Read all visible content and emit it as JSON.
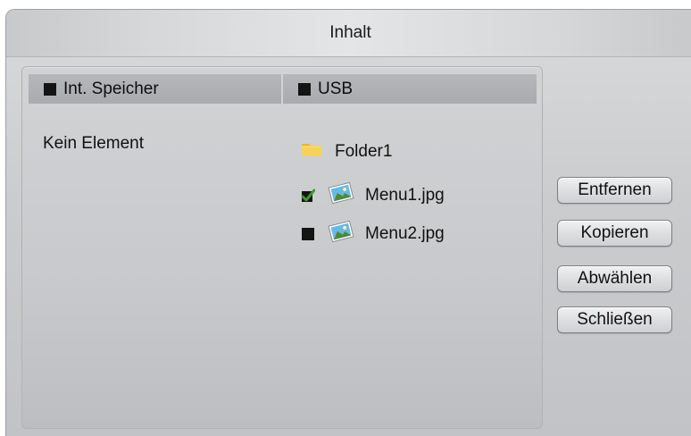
{
  "dialog": {
    "title": "Inhalt"
  },
  "columns": {
    "left": {
      "label": "Int. Speicher",
      "empty_text": "Kein Element"
    },
    "right": {
      "label": "USB"
    }
  },
  "usb_items": [
    {
      "label": "Folder1",
      "icon": "folder-icon",
      "checked": null
    },
    {
      "label": "Menu1.jpg",
      "icon": "image-file-icon",
      "checked": true
    },
    {
      "label": "Menu2.jpg",
      "icon": "image-file-icon",
      "checked": false
    }
  ],
  "actions": {
    "remove_label": "Entfernen",
    "copy_label": "Kopieren",
    "deselect_label": "Abwählen",
    "close_label": "Schließen"
  },
  "colors": {
    "checkmark": "#3a9a2a",
    "folder": "#f2c84b"
  }
}
